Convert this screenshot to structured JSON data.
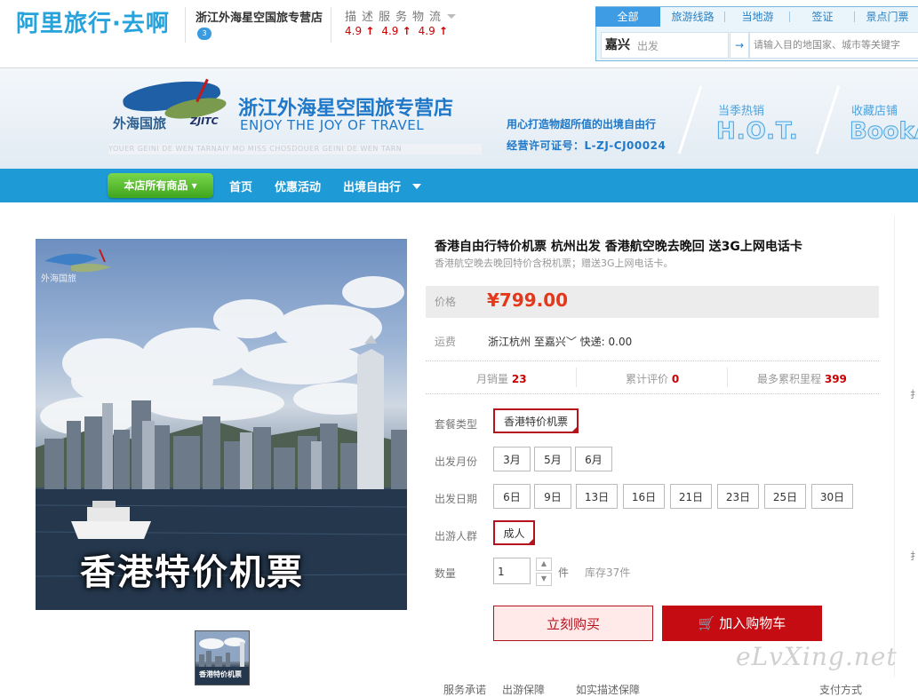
{
  "header": {
    "logo": "阿里旅行·去啊",
    "shop_name": "浙江外海星空国旅专营店",
    "ww_badge": "3",
    "dsr_title": "描述服务物流",
    "dsr_scores": [
      "4.9",
      "4.9",
      "4.9"
    ]
  },
  "search": {
    "tabs": [
      "全部",
      "旅游线路",
      "当地游",
      "签证",
      "景点门票"
    ],
    "active_tab": "全部",
    "from_city": "嘉兴",
    "from_placeholder": "出发",
    "swap_icon": "→",
    "to_placeholder": "请输入目的地国家、城市等关键字"
  },
  "banner": {
    "logo_cn": "外海国旅",
    "logo_en": "ZJITC",
    "title": "浙江外海星空国旅专营店",
    "subtitle": "ENJOY THE JOY OF TRAVEL",
    "strip_text": "YOUER GEINI DE WEN TARNAIY MO MISS CHOSDOUER GEINI DE WEN TARN",
    "slogan1": "用心打造物超所值的出境自由行",
    "slogan2": "经营许可证号：L-ZJ-CJ00024",
    "hot_label": "当季热销",
    "hot_big": "H.O.T.",
    "fav_label": "收藏店铺",
    "fav_big": "BookA"
  },
  "nav": {
    "all_products": "本店所有商品",
    "items": [
      "首页",
      "优惠活动",
      "出境自由行"
    ]
  },
  "product": {
    "image_caption": "香港特价机票",
    "image_logo": "外海国旅",
    "thumb_caption": "香港特价机票",
    "title": "香港自由行特价机票 杭州出发 香港航空晚去晚回 送3G上网电话卡",
    "subtitle": "香港航空晚去晚回特价含税机票；赠送3G上网电话卡。",
    "price_label": "价格",
    "price": "¥799.00",
    "ship_label": "运费",
    "ship_value": "浙江杭州  至嘉兴",
    "ship_fee": "快递: 0.00",
    "stats": [
      {
        "label": "月销量",
        "value": "23"
      },
      {
        "label": "累计评价",
        "value": "0"
      },
      {
        "label": "最多累积里程",
        "value": "399"
      }
    ],
    "package_label": "套餐类型",
    "package_option": "香港特价机票",
    "month_label": "出发月份",
    "months": [
      "3月",
      "5月",
      "6月"
    ],
    "date_label": "出发日期",
    "dates": [
      "6日",
      "9日",
      "13日",
      "16日",
      "21日",
      "23日",
      "25日",
      "30日"
    ],
    "crowd_label": "出游人群",
    "crowd_option": "成人",
    "qty_label": "数量",
    "qty_value": "1",
    "qty_unit": "件",
    "stock": "库存37件",
    "buy_now": "立刻购买",
    "add_cart": "加入购物车"
  },
  "bottom": {
    "items": [
      "服务承诺",
      "出游保障",
      "如实描述保障",
      "支付方式"
    ]
  },
  "watermark": "eLvXing.net",
  "edge_chars": [
    "扌",
    "扌"
  ]
}
